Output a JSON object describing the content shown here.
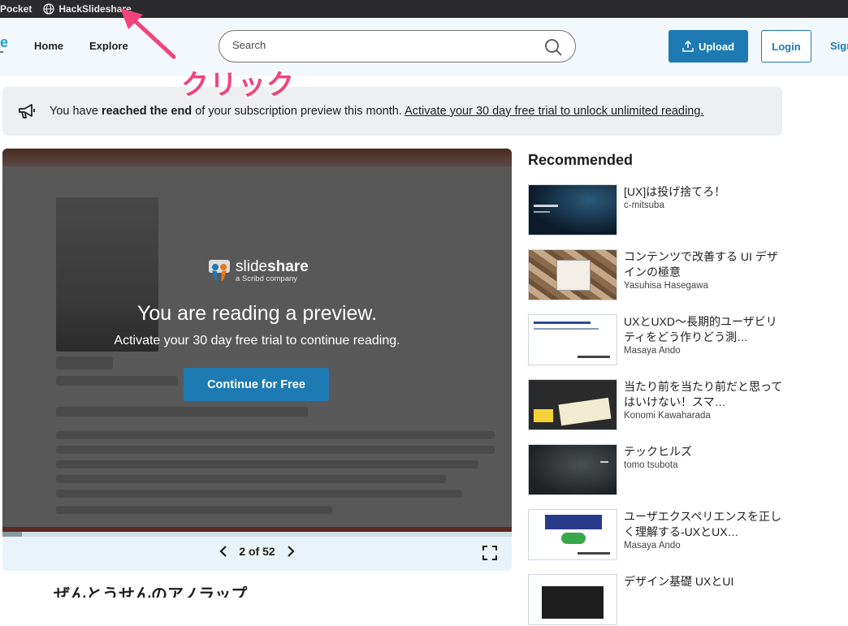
{
  "bookmarks": [
    {
      "label": "Pocket",
      "icon": "none"
    },
    {
      "label": "HackSlideshare",
      "icon": "globe-icon"
    }
  ],
  "header": {
    "logo_fragment": "e",
    "nav": {
      "home": "Home",
      "explore": "Explore"
    },
    "search_placeholder": "Search",
    "upload_label": "Upload",
    "login_label": "Login",
    "signup_fragment": "Sign"
  },
  "annotation": {
    "text": "クリック",
    "color": "#f2437a"
  },
  "notice": {
    "prefix": "You have ",
    "bold": "reached the end",
    "middle": " of your subscription preview this month. ",
    "link": "Activate your 30 day free trial to unlock unlimited reading."
  },
  "viewer": {
    "logo_name_light": "slide",
    "logo_name_bold": "share",
    "logo_sub": "a Scribd company",
    "title": "You are reading a preview.",
    "subtitle": "Activate your 30 day free trial to continue reading.",
    "cta_label": "Continue for Free",
    "page_indicator": "2 of 52",
    "progress_fraction": 0.038
  },
  "below_heading": "ぜんとうせんのアノラップ",
  "recommended": {
    "title": "Recommended",
    "items": [
      {
        "title": "[UX]は投げ捨てろ！",
        "author": "c-mitsuba",
        "thumb": "night-sky"
      },
      {
        "title": "コンテンツで改善する UI デザインの極意",
        "author": "Yasuhisa Hasegawa",
        "thumb": "content-cubes"
      },
      {
        "title": "UXとUXD〜長期的ユーザビリティをどう作りどう測…",
        "author": "Masaya Ando",
        "thumb": "white-doc"
      },
      {
        "title": "当たり前を当たり前だと思ってはいけない！スマ…",
        "author": "Konomi Kawaharada",
        "thumb": "chalkboard"
      },
      {
        "title": "テックヒルズ",
        "author": "tomo tsubota",
        "thumb": "dark-ux"
      },
      {
        "title": "ユーザエクスペリエンスを正しく理解する-UXとUX…",
        "author": "Masaya Ando",
        "thumb": "white-doc-2"
      },
      {
        "title": "デザイン基礎 UXとUI",
        "author": "",
        "thumb": "black-card"
      }
    ]
  },
  "colors": {
    "brand_blue": "#1d7ab2",
    "annotation_pink": "#f2437a"
  }
}
